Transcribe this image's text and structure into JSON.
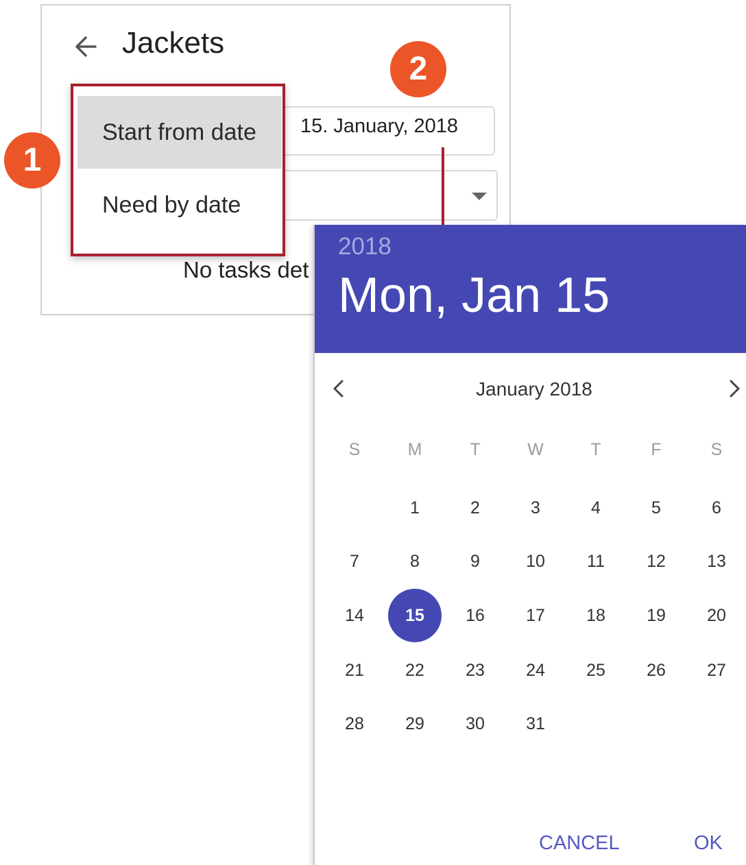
{
  "screen": {
    "title": "Jackets",
    "date_field_value": "15. January, 2018",
    "empty_message": "No tasks det"
  },
  "menu": {
    "items": [
      {
        "label": "Start from date",
        "selected": true
      },
      {
        "label": "Need by date",
        "selected": false
      }
    ]
  },
  "badges": {
    "step1": "1",
    "step2": "2"
  },
  "colors": {
    "accent": "#4548b2",
    "badge": "#ec5528",
    "highlight_border": "#a8202d"
  },
  "picker": {
    "header_year": "2018",
    "header_date": "Mon, Jan 15",
    "month_label": "January 2018",
    "weekdays": [
      "S",
      "M",
      "T",
      "W",
      "T",
      "F",
      "S"
    ],
    "weeks": [
      [
        "",
        "1",
        "2",
        "3",
        "4",
        "5",
        "6"
      ],
      [
        "7",
        "8",
        "9",
        "10",
        "11",
        "12",
        "13"
      ],
      [
        "14",
        "15",
        "16",
        "17",
        "18",
        "19",
        "20"
      ],
      [
        "21",
        "22",
        "23",
        "24",
        "25",
        "26",
        "27"
      ],
      [
        "28",
        "29",
        "30",
        "31",
        "",
        "",
        ""
      ]
    ],
    "selected_day": "15",
    "cancel_label": "CANCEL",
    "ok_label": "OK"
  }
}
